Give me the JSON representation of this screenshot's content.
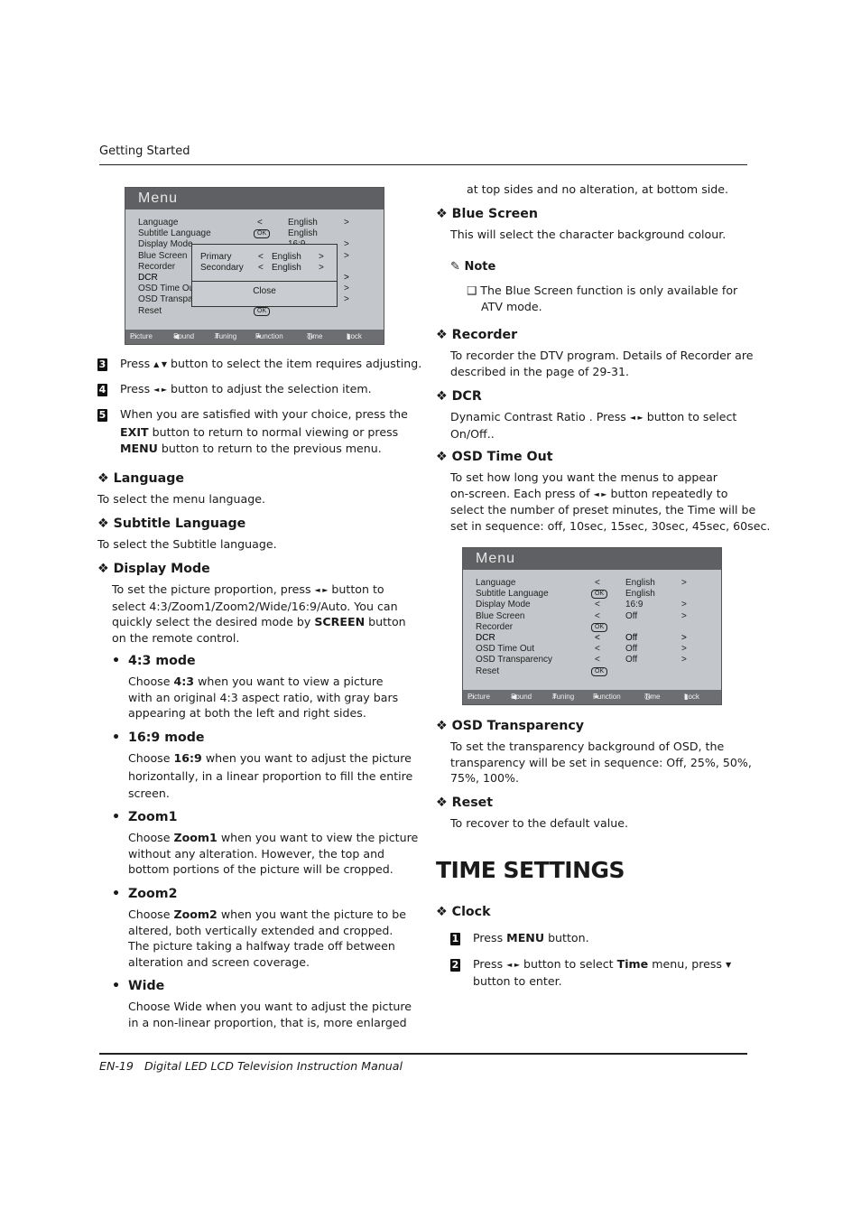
{
  "header": {
    "section": "Getting Started"
  },
  "footer": {
    "page": "EN-19",
    "title": "Digital LED LCD Television Instruction Manual"
  },
  "menu_common": {
    "title": "Menu",
    "tabs": [
      {
        "label": "Picture",
        "icon": "monitor-icon"
      },
      {
        "label": "Sound",
        "icon": "speaker-icon"
      },
      {
        "label": "Tuning",
        "icon": "grid-icon"
      },
      {
        "label": "Function",
        "icon": "star-icon"
      },
      {
        "label": "Time",
        "icon": "clock-icon"
      },
      {
        "label": "Lock",
        "icon": "lock-icon"
      }
    ],
    "selected_tab": "Function"
  },
  "menu1": {
    "rows": [
      {
        "label": "Language",
        "ctrl": "<",
        "value": "English",
        "next": ">"
      },
      {
        "label": "Subtitle Language",
        "ctrl": "OK",
        "value": "English",
        "next": ""
      },
      {
        "label": "Display Mode",
        "ctrl": "",
        "value": "16:9",
        "next": ">"
      },
      {
        "label": "Blue Screen",
        "ctrl": "",
        "value": "",
        "next": ">"
      },
      {
        "label": "Recorder",
        "ctrl": "",
        "value": "",
        "next": ""
      },
      {
        "label": "DCR",
        "ctrl": "",
        "value": "",
        "next": ">"
      },
      {
        "label": "OSD Time Out",
        "ctrl": "",
        "value": "",
        "next": ">"
      },
      {
        "label": "OSD Transparency",
        "ctrl": "",
        "value": "",
        "next": ">"
      },
      {
        "label": "Reset",
        "ctrl": "OK",
        "value": "",
        "next": ""
      }
    ],
    "popup": {
      "rows": [
        {
          "label": "Primary",
          "prev": "<",
          "value": "English",
          "next": ">"
        },
        {
          "label": "Secondary",
          "prev": "<",
          "value": "English",
          "next": ">"
        }
      ],
      "close": "Close"
    }
  },
  "menu2": {
    "rows": [
      {
        "label": "Language",
        "ctrl": "<",
        "value": "English",
        "next": ">"
      },
      {
        "label": "Subtitle Language",
        "ctrl": "OK",
        "value": "English",
        "next": ""
      },
      {
        "label": "Display Mode",
        "ctrl": "<",
        "value": "16:9",
        "next": ">"
      },
      {
        "label": "Blue Screen",
        "ctrl": "<",
        "value": "Off",
        "next": ">"
      },
      {
        "label": "Recorder",
        "ctrl": "OK",
        "value": "",
        "next": ""
      },
      {
        "label": "DCR",
        "ctrl": "<",
        "value": "Off",
        "next": ">"
      },
      {
        "label": "OSD Time Out",
        "ctrl": "<",
        "value": "Off",
        "next": ">"
      },
      {
        "label": "OSD Transparency",
        "ctrl": "<",
        "value": "Off",
        "next": ">"
      },
      {
        "label": "Reset",
        "ctrl": "OK",
        "value": "",
        "next": ""
      }
    ]
  },
  "left": {
    "step3": {
      "num": "3",
      "t1": "Press ",
      "arrows": "▲ ▼",
      "t2": " button to select the item requires adjusting."
    },
    "step4": {
      "num": "4",
      "t1": "Press ",
      "arrows": "◄ ►",
      "t2": " button to adjust the selection item."
    },
    "step5": {
      "num": "5",
      "l1": "When you are satisfied with your choice, press the",
      "l2b": "EXIT",
      "l2": " button to return to normal viewing or press",
      "l3b": "MENU",
      "l3": " button to return to the previous menu."
    },
    "language": {
      "h": "❖ Language",
      "t": "To select the menu language."
    },
    "subtitle": {
      "h": "❖ Subtitle Language",
      "t": "To select the Subtitle language."
    },
    "display": {
      "h": "❖ Display Mode",
      "l1a": "To set the picture proportion, press ",
      "arrows": "◄ ►",
      "l1b": " button to",
      "l2": "select 4:3/Zoom1/Zoom2/Wide/16:9/Auto. You can",
      "l3a": "quickly select the desired mode by ",
      "l3b": "SCREEN",
      "l3c": " button",
      "l4": "on the remote control."
    },
    "m43": {
      "h": "4:3 mode",
      "l1a": "Choose ",
      "l1b": "4:3",
      "l1c": " when you want to view a picture",
      "l2": "with an original 4:3 aspect ratio, with gray bars",
      "l3": "appearing at both the left and right sides."
    },
    "m169": {
      "h": "16:9 mode",
      "l1a": "Choose ",
      "l1b": "16:9",
      "l1c": " when you want to adjust the picture",
      "l2": "horizontally, in a linear proportion to fill the entire",
      "l3": "screen."
    },
    "zoom1": {
      "h": "Zoom1",
      "l1a": "Choose ",
      "l1b": "Zoom1",
      "l1c": " when you want to view the picture",
      "l2": "without any alteration. However, the top and",
      "l3": "bottom portions of the picture will be cropped."
    },
    "zoom2": {
      "h": "Zoom2",
      "l1a": "Choose ",
      "l1b": "Zoom2",
      "l1c": " when you want the picture to be",
      "l2": "altered, both vertically extended and cropped.",
      "l3": "The picture taking a halfway trade off between",
      "l4": "alteration and screen coverage."
    },
    "wide": {
      "h": "Wide",
      "l1": "Choose Wide when you want to adjust the picture",
      "l2": "in a non-linear proportion, that is, more enlarged"
    },
    "bullet": "•"
  },
  "right": {
    "cont": "at top sides and no alteration, at bottom side.",
    "blue": {
      "h": "❖ Blue Screen",
      "t": "This will select the character background colour."
    },
    "note": {
      "h": "Note",
      "l1": "❑ The Blue Screen function is only available for",
      "l2": "ATV mode."
    },
    "recorder": {
      "h": "❖ Recorder",
      "l1": "To recorder the DTV program. Details of Recorder are",
      "l2": "described in the page of 29-31."
    },
    "dcr": {
      "h": "❖ DCR",
      "l1a": "Dynamic Contrast Ratio . Press ",
      "arrows": "◄ ►",
      "l1b": " button to select",
      "l2": "On/Off.."
    },
    "osdto": {
      "h": "❖ OSD Time Out",
      "l1": "To set how long you want the menus to appear",
      "l2a": "on-screen. Each press of ",
      "arrows": "◄ ►",
      "l2b": " button repeatedly to",
      "l3": "select the number of preset minutes, the Time will be",
      "l4": "set in sequence: off, 10sec, 15sec, 30sec, 45sec, 60sec."
    },
    "osdtr": {
      "h": "❖ OSD Transparency",
      "l1": "To set the transparency background of OSD, the",
      "l2": "transparency will be set in sequence: Off, 25%, 50%,",
      "l3": "75%, 100%."
    },
    "reset": {
      "h": "❖ Reset",
      "t": "To recover to the default value."
    },
    "time_title": "TIME SETTINGS",
    "clock": {
      "h": "❖ Clock"
    },
    "step1": {
      "num": "1",
      "a": "Press ",
      "b": "MENU",
      "c": " button."
    },
    "step2": {
      "num": "2",
      "a": "Press ",
      "arrows": "◄ ►",
      "b": " button to select ",
      "c": "Time",
      "d": " menu, press ",
      "arrow2": "▼",
      "l2": "button to enter."
    }
  }
}
